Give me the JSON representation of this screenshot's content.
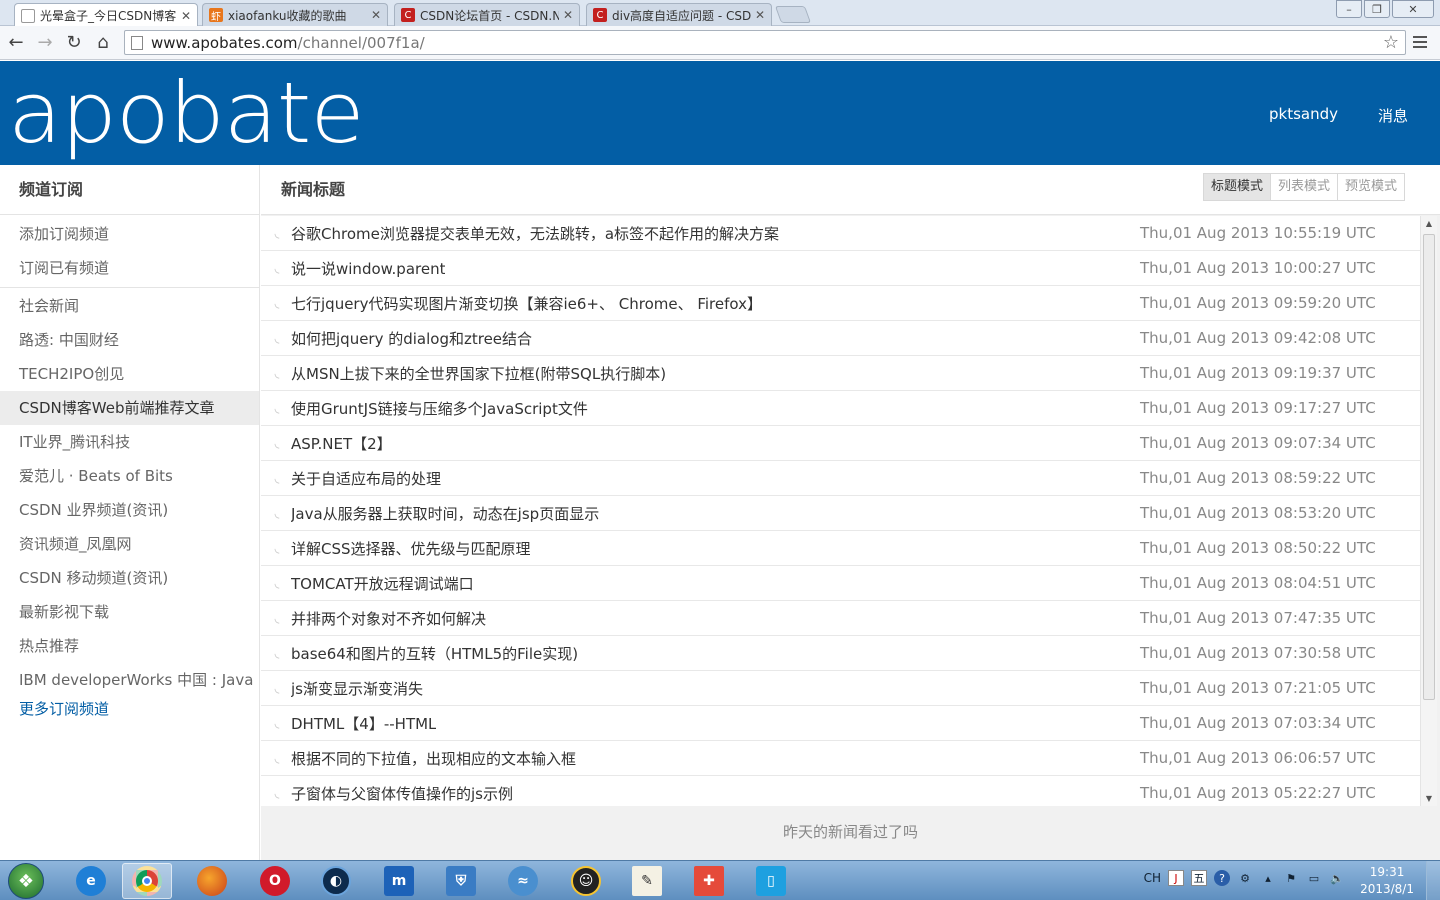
{
  "browser": {
    "tabs": [
      {
        "title": "光晕盒子_今日CSDN博客",
        "active": true
      },
      {
        "title": "xiaofanku收藏的歌曲",
        "active": false
      },
      {
        "title": "CSDN论坛首页 - CSDN.N",
        "active": false
      },
      {
        "title": "div高度自适应问题 - CSD",
        "active": false
      }
    ],
    "url_domain": "www.apobates.com",
    "url_path": "/channel/007f1a/"
  },
  "header": {
    "logo": "apobate",
    "user": "pktsandy",
    "messages": "消息",
    "bg_color": "#035ea5"
  },
  "sidebar": {
    "title": "频道订阅",
    "actions": [
      "添加订阅频道",
      "订阅已有频道"
    ],
    "channels": [
      "社会新闻",
      "路透: 中国财经",
      "TECH2IPO创见",
      "CSDN博客Web前端推荐文章",
      "IT业界_腾讯科技",
      "爱范儿 · Beats of Bits",
      "CSDN 业界频道(资讯)",
      "资讯频道_凤凰网",
      "CSDN 移动频道(资讯)",
      "最新影视下载",
      "热点推荐",
      "IBM developerWorks 中国 : Java"
    ],
    "active_channel": "CSDN博客Web前端推荐文章",
    "more": "更多订阅频道"
  },
  "main": {
    "title": "新闻标题",
    "modes": [
      "标题模式",
      "列表模式",
      "预览模式"
    ],
    "active_mode": "标题模式",
    "articles": [
      {
        "title": "谷歌Chrome浏览器提交表单无效，无法跳转，a标签不起作用的解决方案",
        "time": "Thu,01 Aug 2013 10:55:19 UTC"
      },
      {
        "title": "说一说window.parent",
        "time": "Thu,01 Aug 2013 10:00:27 UTC"
      },
      {
        "title": "七行jquery代码实现图片渐变切换【兼容ie6+、 Chrome、 Firefox】",
        "time": "Thu,01 Aug 2013 09:59:20 UTC"
      },
      {
        "title": "如何把jquery 的dialog和ztree结合",
        "time": "Thu,01 Aug 2013 09:42:08 UTC"
      },
      {
        "title": "从MSN上拔下来的全世界国家下拉框(附带SQL执行脚本)",
        "time": "Thu,01 Aug 2013 09:19:37 UTC"
      },
      {
        "title": "使用GruntJS链接与压缩多个JavaScript文件",
        "time": "Thu,01 Aug 2013 09:17:27 UTC"
      },
      {
        "title": "ASP.NET【2】",
        "time": "Thu,01 Aug 2013 09:07:34 UTC"
      },
      {
        "title": "关于自适应布局的处理",
        "time": "Thu,01 Aug 2013 08:59:22 UTC"
      },
      {
        "title": "Java从服务器上获取时间，动态在jsp页面显示",
        "time": "Thu,01 Aug 2013 08:53:20 UTC"
      },
      {
        "title": "详解CSS选择器、优先级与匹配原理",
        "time": "Thu,01 Aug 2013 08:50:22 UTC"
      },
      {
        "title": "TOMCAT开放远程调试端口",
        "time": "Thu,01 Aug 2013 08:04:51 UTC"
      },
      {
        "title": "并排两个对象对不齐如何解决",
        "time": "Thu,01 Aug 2013 07:47:35 UTC"
      },
      {
        "title": "base64和图片的互转（HTML5的File实现)",
        "time": "Thu,01 Aug 2013 07:30:58 UTC"
      },
      {
        "title": "js渐变显示渐变消失",
        "time": "Thu,01 Aug 2013 07:21:05 UTC"
      },
      {
        "title": "DHTML【4】--HTML",
        "time": "Thu,01 Aug 2013 07:03:34 UTC"
      },
      {
        "title": "根据不同的下拉值，出现相应的文本输入框",
        "time": "Thu,01 Aug 2013 06:06:57 UTC"
      },
      {
        "title": "子窗体与父窗体传值操作的js示例",
        "time": "Thu,01 Aug 2013 05:22:27 UTC"
      }
    ],
    "footer": "昨天的新闻看过了吗"
  },
  "taskbar": {
    "apps": [
      "ie-icon",
      "chrome-icon",
      "firefox-icon",
      "opera-icon",
      "app-icon",
      "maxthon-icon",
      "network-icon",
      "dolphin-icon",
      "qq-icon",
      "notepad-icon",
      "paint-icon",
      "phone-icon"
    ],
    "tray_lang": "CH",
    "time": "19:31",
    "date": "2013/8/1"
  }
}
